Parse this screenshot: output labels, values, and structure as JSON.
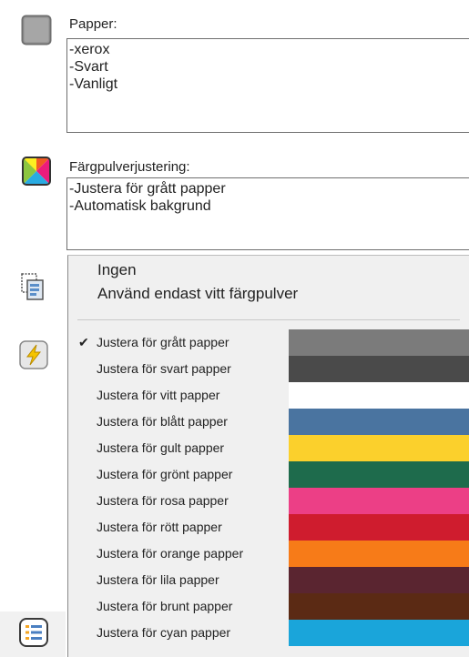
{
  "paper": {
    "label": "Papper:",
    "lines": [
      "-xerox",
      "-Svart",
      "-Vanligt"
    ]
  },
  "toner": {
    "label": "Färgpulverjustering:",
    "lines": [
      "-Justera för grått papper",
      "-Automatisk bakgrund"
    ]
  },
  "menu": {
    "top_items": [
      "Ingen",
      "Använd endast vitt färgpulver"
    ],
    "check_glyph": "✔",
    "options": [
      {
        "label": "Justera för grått papper",
        "checked": true,
        "color": "#7b7b7b"
      },
      {
        "label": "Justera för svart papper",
        "checked": false,
        "color": "#4a4a4a"
      },
      {
        "label": "Justera för vitt papper",
        "checked": false,
        "color": "#ffffff"
      },
      {
        "label": "Justera för blått papper",
        "checked": false,
        "color": "#4a74a0"
      },
      {
        "label": "Justera för gult papper",
        "checked": false,
        "color": "#fbd02c"
      },
      {
        "label": "Justera för grönt papper",
        "checked": false,
        "color": "#1e6b4c"
      },
      {
        "label": "Justera för rosa papper",
        "checked": false,
        "color": "#ec3f86"
      },
      {
        "label": "Justera för rött papper",
        "checked": false,
        "color": "#cf1c2e"
      },
      {
        "label": "Justera för orange papper",
        "checked": false,
        "color": "#f77b18"
      },
      {
        "label": "Justera för lila papper",
        "checked": false,
        "color": "#5a2530"
      },
      {
        "label": "Justera för brunt papper",
        "checked": false,
        "color": "#5b2a14"
      },
      {
        "label": "Justera för cyan papper",
        "checked": false,
        "color": "#1aa5da"
      }
    ]
  },
  "icons": {
    "paper": "paper-gray-square-icon",
    "toner": "color-toner-icon",
    "copy": "copy-pages-icon",
    "quick": "lightning-icon",
    "list": "list-settings-icon"
  }
}
